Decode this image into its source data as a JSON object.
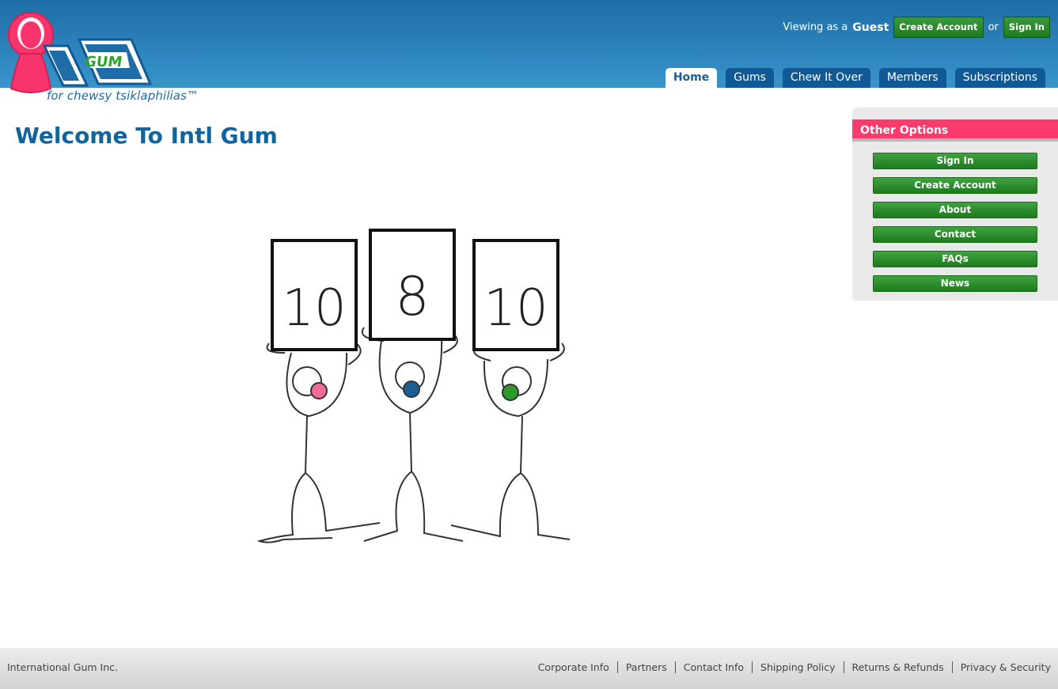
{
  "header": {
    "logo_text": "GUM",
    "tagline": "for chewsy tsiklaphilias™",
    "viewing_prefix": "Viewing as a",
    "viewer": "Guest",
    "create_account": "Create Account",
    "or": "or",
    "sign_in": "Sign In",
    "tabs": [
      {
        "label": "Home",
        "active": true
      },
      {
        "label": "Gums",
        "active": false
      },
      {
        "label": "Chew It Over",
        "active": false
      },
      {
        "label": "Members",
        "active": false
      },
      {
        "label": "Subscriptions",
        "active": false
      }
    ]
  },
  "main": {
    "title": "Welcome To Intl Gum",
    "illustration": {
      "scores": [
        "10",
        "8",
        "10"
      ],
      "gum_colors": [
        "#f26b9b",
        "#1c5f94",
        "#2a9a2a"
      ]
    }
  },
  "sidebar": {
    "title": "Other Options",
    "buttons": [
      "Sign In",
      "Create Account",
      "About",
      "Contact",
      "FAQs",
      "News"
    ]
  },
  "footer": {
    "company": "International Gum Inc.",
    "links": [
      "Corporate Info",
      "Partners",
      "Contact Info",
      "Shipping Policy",
      "Returns & Refunds",
      "Privacy & Security"
    ]
  },
  "colors": {
    "header_blue": "#2a7fbb",
    "tab_blue": "#0f5a96",
    "accent_pink": "#fb3b6b",
    "button_green": "#2a8f2a",
    "title_blue": "#14649c"
  }
}
